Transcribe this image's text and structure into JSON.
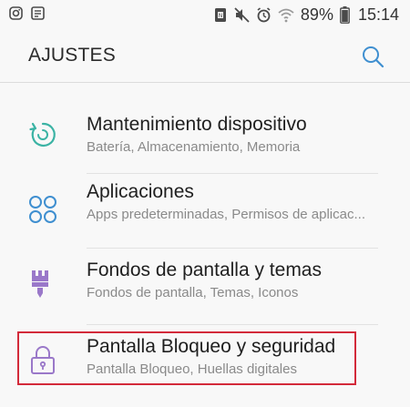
{
  "status_bar": {
    "left_icons": [
      "instagram-icon",
      "notes-icon"
    ],
    "right_icons": [
      "nfc-icon",
      "mute-icon",
      "alarm-icon",
      "wifi-icon",
      "battery-icon"
    ],
    "battery": "89%",
    "time": "15:14"
  },
  "app_bar": {
    "title": "AJUSTES",
    "search_icon": "search-icon"
  },
  "items": [
    {
      "icon": "device-maintenance-icon",
      "title": "Mantenimiento dispositivo",
      "subtitle": "Batería, Almacenamiento, Memoria"
    },
    {
      "icon": "apps-icon",
      "title": "Aplicaciones",
      "subtitle": "Apps predeterminadas, Permisos de aplicac..."
    },
    {
      "icon": "paint-brush-icon",
      "title": "Fondos de pantalla y temas",
      "subtitle": "Fondos de pantalla, Temas, Iconos"
    },
    {
      "icon": "lock-icon",
      "title": "Pantalla Bloqueo y seguridad",
      "subtitle": "Pantalla Bloqueo, Huellas digitales"
    }
  ],
  "colors": {
    "teal": "#3bb3a4",
    "blue": "#3f8fd0",
    "purple": "#9a78c9",
    "highlight": "#d32a3a"
  }
}
